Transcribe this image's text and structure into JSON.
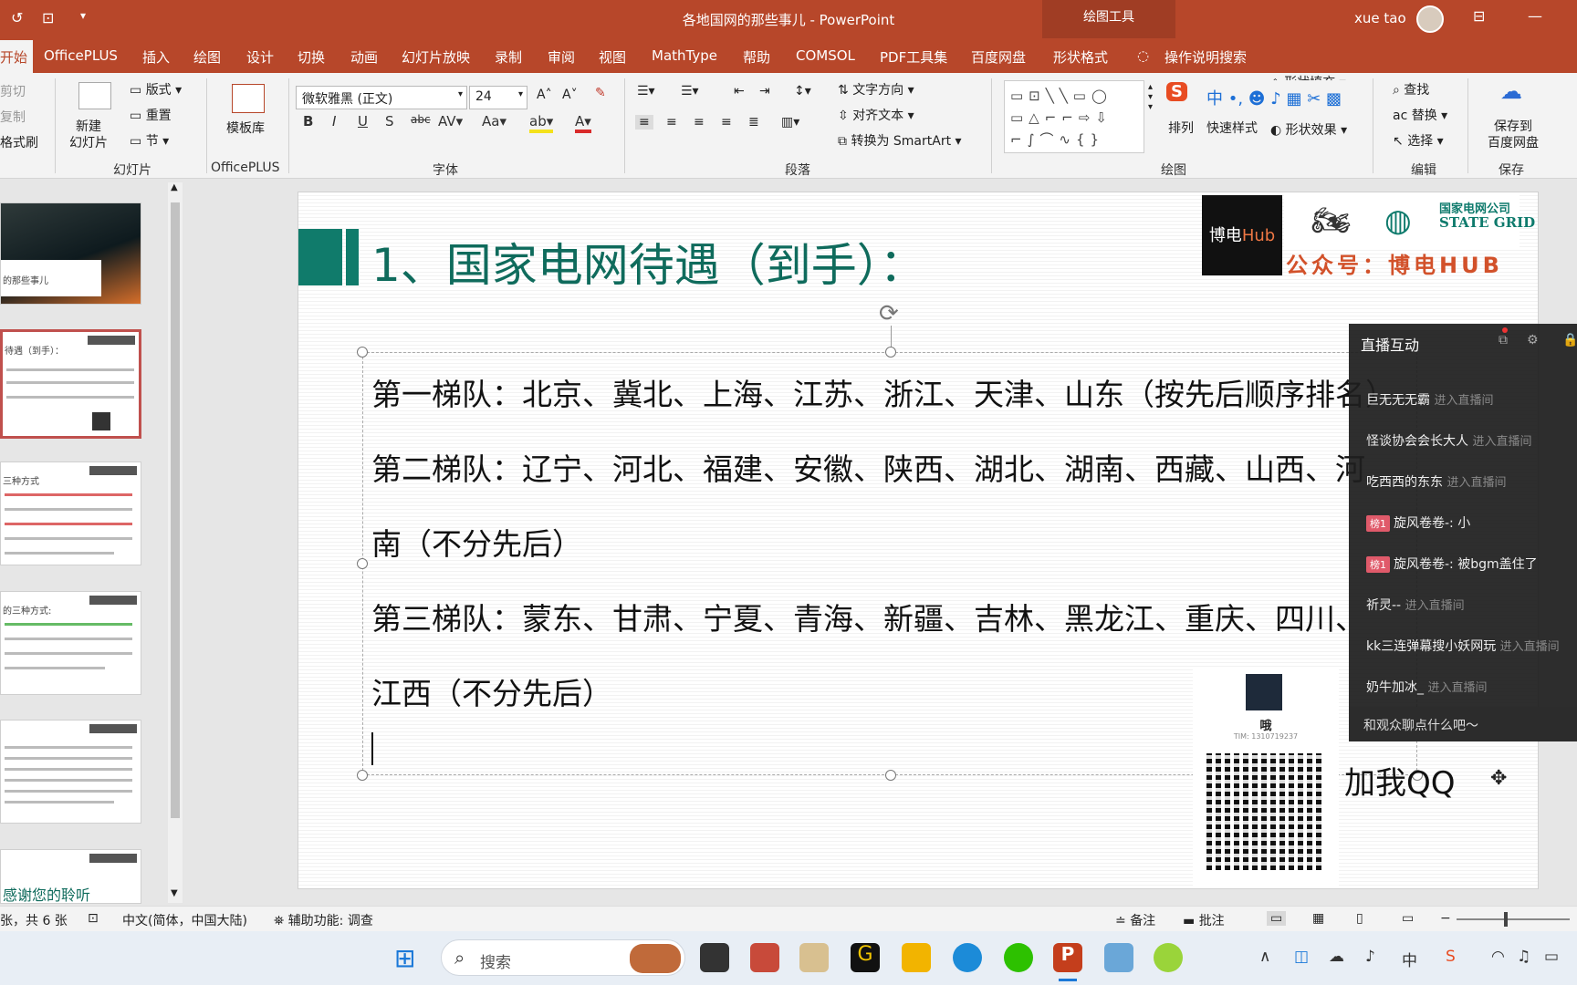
{
  "window": {
    "title": "各地国网的那些事儿 - PowerPoint",
    "contextual_tab_group": "绘图工具",
    "user_name": "xue tao"
  },
  "tabs": [
    "开始",
    "OfficePLUS",
    "插入",
    "绘图",
    "设计",
    "切换",
    "动画",
    "幻灯片放映",
    "录制",
    "审阅",
    "视图",
    "MathType",
    "帮助",
    "COMSOL",
    "PDF工具集",
    "百度网盘",
    "形状格式"
  ],
  "tell_me": "操作说明搜索",
  "ribbon": {
    "clipboard": {
      "cut": "剪切",
      "copy": "复制",
      "painter": "格式刷"
    },
    "slides": {
      "new_slide": "新建\n幻灯片",
      "layout": "版式",
      "reset": "重置",
      "section": "节",
      "label": "幻灯片"
    },
    "officeplus": {
      "templates": "模板库",
      "label": "OfficePLUS"
    },
    "font": {
      "name": "微软雅黑 (正文)",
      "size": "24",
      "label": "字体"
    },
    "paragraph": {
      "text_direction": "文字方向",
      "align_text": "对齐文本",
      "smartart": "转换为 SmartArt",
      "label": "段落"
    },
    "drawing": {
      "arrange": "排列",
      "quick_styles": "快速样式",
      "shape_fill": "形状填充",
      "shape_effects": "形状效果",
      "label": "绘图"
    },
    "editing": {
      "find": "查找",
      "replace": "替换",
      "select": "选择",
      "label": "编辑"
    },
    "save": {
      "save_baidu": "保存到\n百度网盘",
      "label": "保存"
    }
  },
  "thumbnails": [
    {
      "text": "的那些事儿"
    },
    {
      "text": "待遇（到手）："
    },
    {
      "text": "三种方式"
    },
    {
      "text": "的三种方式:"
    },
    {
      "text": ""
    },
    {
      "text": "感谢您的聆听"
    }
  ],
  "slide": {
    "title": "1、国家电网待遇（到手）：",
    "lines": [
      "第一梯队：北京、冀北、上海、江苏、浙江、天津、山东（按先后顺序排名）",
      "第二梯队：辽宁、河北、福建、安徽、陕西、湖北、湖南、西藏、山西、河",
      "南（不分先后）",
      "第三梯队：蒙东、甘肃、宁夏、青海、新疆、吉林、黑龙江、重庆、四川、",
      "江西（不分先后）"
    ],
    "brand_logo": "博电",
    "brand_logo_accent": "Hub",
    "brand_sub": "公众号：博电HUB",
    "state_grid_cn": "国家电网公司",
    "state_grid_en": "STATE GRID",
    "qr_name": "哦",
    "qr_tim": "TIM: 1310719237",
    "add_qq": "加我QQ"
  },
  "live_chat": {
    "title": "直播互动",
    "items": [
      {
        "user": "巨无无无霸",
        "action": "进入直播间",
        "badge": ""
      },
      {
        "user": "怪谈协会会长大人",
        "action": "进入直播间",
        "badge": ""
      },
      {
        "user": "吃西西的东东",
        "action": "进入直播间",
        "badge": ""
      },
      {
        "user": "旋风卷卷-: 小",
        "action": "",
        "badge": "榜1"
      },
      {
        "user": "旋风卷卷-: 被bgm盖住了",
        "action": "",
        "badge": "榜1"
      },
      {
        "user": "祈灵--",
        "action": "进入直播间",
        "badge": ""
      },
      {
        "user": "kk三连弹幕搜小妖网玩",
        "action": "进入直播间",
        "badge": ""
      },
      {
        "user": "奶牛加冰_",
        "action": "进入直播间",
        "badge": ""
      }
    ],
    "input_placeholder": "和观众聊点什么吧～"
  },
  "statusbar": {
    "slide_count": "张，共 6 张",
    "language": "中文(简体，中国大陆)",
    "accessibility": "辅助功能: 调查",
    "notes": "备注",
    "comments": "批注"
  },
  "taskbar": {
    "search_placeholder": "搜索"
  }
}
